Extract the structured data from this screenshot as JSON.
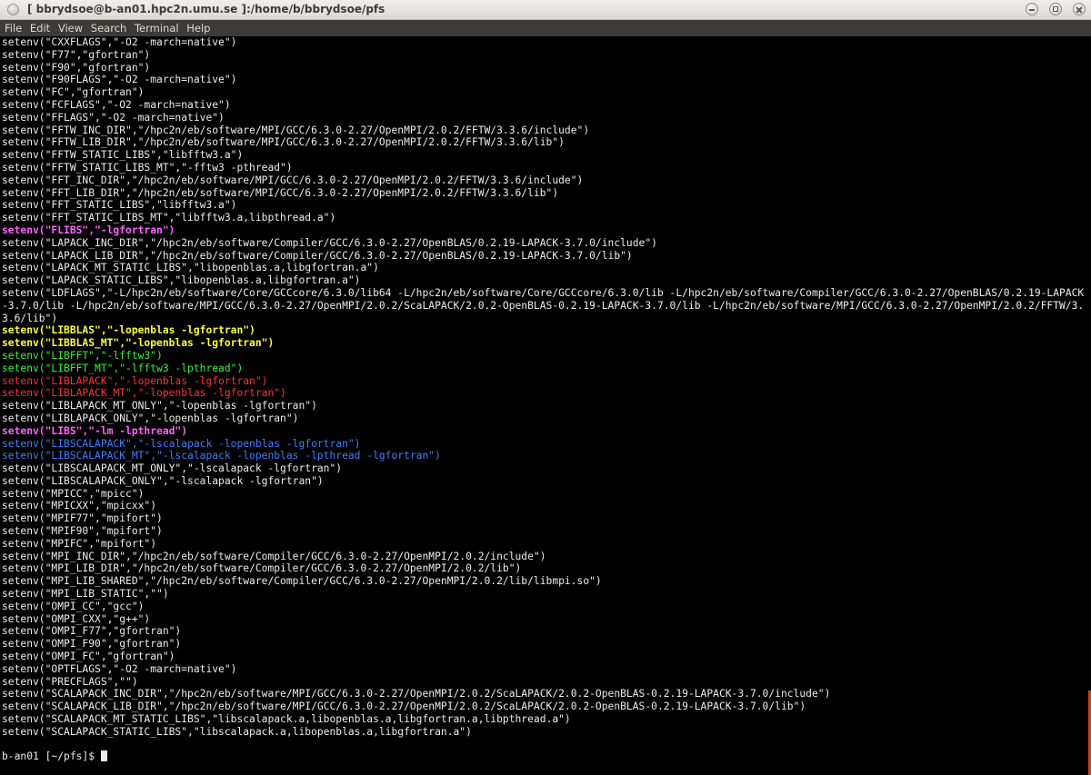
{
  "window": {
    "title": "[ bbrydsoe@b-an01.hpc2n.umu.se ]:/home/b/bbrydsoe/pfs"
  },
  "menubar": {
    "items": [
      "File",
      "Edit",
      "View",
      "Search",
      "Terminal",
      "Help"
    ]
  },
  "colors": {
    "magenta": "#ff62ff",
    "yellow": "#fdfd3a",
    "green": "#3bf03b",
    "red": "#ff3030",
    "blue": "#3f7dff",
    "default": "#ececec",
    "background": "#000000"
  },
  "terminal": {
    "lines": [
      {
        "text": "setenv(\"CXXFLAGS\",\"-O2 -march=native\")",
        "color": ""
      },
      {
        "text": "setenv(\"F77\",\"gfortran\")",
        "color": ""
      },
      {
        "text": "setenv(\"F90\",\"gfortran\")",
        "color": ""
      },
      {
        "text": "setenv(\"F90FLAGS\",\"-O2 -march=native\")",
        "color": ""
      },
      {
        "text": "setenv(\"FC\",\"gfortran\")",
        "color": ""
      },
      {
        "text": "setenv(\"FCFLAGS\",\"-O2 -march=native\")",
        "color": ""
      },
      {
        "text": "setenv(\"FFLAGS\",\"-O2 -march=native\")",
        "color": ""
      },
      {
        "text": "setenv(\"FFTW_INC_DIR\",\"/hpc2n/eb/software/MPI/GCC/6.3.0-2.27/OpenMPI/2.0.2/FFTW/3.3.6/include\")",
        "color": ""
      },
      {
        "text": "setenv(\"FFTW_LIB_DIR\",\"/hpc2n/eb/software/MPI/GCC/6.3.0-2.27/OpenMPI/2.0.2/FFTW/3.3.6/lib\")",
        "color": ""
      },
      {
        "text": "setenv(\"FFTW_STATIC_LIBS\",\"libfftw3.a\")",
        "color": ""
      },
      {
        "text": "setenv(\"FFTW_STATIC_LIBS_MT\",\"-fftw3 -pthread\")",
        "color": ""
      },
      {
        "text": "setenv(\"FFT_INC_DIR\",\"/hpc2n/eb/software/MPI/GCC/6.3.0-2.27/OpenMPI/2.0.2/FFTW/3.3.6/include\")",
        "color": ""
      },
      {
        "text": "setenv(\"FFT_LIB_DIR\",\"/hpc2n/eb/software/MPI/GCC/6.3.0-2.27/OpenMPI/2.0.2/FFTW/3.3.6/lib\")",
        "color": ""
      },
      {
        "text": "setenv(\"FFT_STATIC_LIBS\",\"libfftw3.a\")",
        "color": ""
      },
      {
        "text": "setenv(\"FFT_STATIC_LIBS_MT\",\"libfftw3.a,libpthread.a\")",
        "color": ""
      },
      {
        "text": "setenv(\"FLIBS\",\"-lgfortran\")",
        "color": "magenta"
      },
      {
        "text": "setenv(\"LAPACK_INC_DIR\",\"/hpc2n/eb/software/Compiler/GCC/6.3.0-2.27/OpenBLAS/0.2.19-LAPACK-3.7.0/include\")",
        "color": ""
      },
      {
        "text": "setenv(\"LAPACK_LIB_DIR\",\"/hpc2n/eb/software/Compiler/GCC/6.3.0-2.27/OpenBLAS/0.2.19-LAPACK-3.7.0/lib\")",
        "color": ""
      },
      {
        "text": "setenv(\"LAPACK_MT_STATIC_LIBS\",\"libopenblas.a,libgfortran.a\")",
        "color": ""
      },
      {
        "text": "setenv(\"LAPACK_STATIC_LIBS\",\"libopenblas.a,libgfortran.a\")",
        "color": ""
      },
      {
        "text": "setenv(\"LDFLAGS\",\"-L/hpc2n/eb/software/Core/GCCcore/6.3.0/lib64 -L/hpc2n/eb/software/Core/GCCcore/6.3.0/lib -L/hpc2n/eb/software/Compiler/GCC/6.3.0-2.27/OpenBLAS/0.2.19-LAPACK-3.7.0/lib -L/hpc2n/eb/software/MPI/GCC/6.3.0-2.27/OpenMPI/2.0.2/ScaLAPACK/2.0.2-OpenBLAS-0.2.19-LAPACK-3.7.0/lib -L/hpc2n/eb/software/MPI/GCC/6.3.0-2.27/OpenMPI/2.0.2/FFTW/3.3.6/lib\")",
        "color": "",
        "wrap": true
      },
      {
        "text": "setenv(\"LIBBLAS\",\"-lopenblas -lgfortran\")",
        "color": "yellow"
      },
      {
        "text": "setenv(\"LIBBLAS_MT\",\"-lopenblas -lgfortran\")",
        "color": "yellow"
      },
      {
        "text": "setenv(\"LIBFFT\",\"-lfftw3\")",
        "color": "green"
      },
      {
        "text": "setenv(\"LIBFFT_MT\",\"-lfftw3 -lpthread\")",
        "color": "green"
      },
      {
        "text": "setenv(\"LIBLAPACK\",\"-lopenblas -lgfortran\")",
        "color": "red"
      },
      {
        "text": "setenv(\"LIBLAPACK_MT\",\"-lopenblas -lgfortran\")",
        "color": "red"
      },
      {
        "text": "setenv(\"LIBLAPACK_MT_ONLY\",\"-lopenblas -lgfortran\")",
        "color": ""
      },
      {
        "text": "setenv(\"LIBLAPACK_ONLY\",\"-lopenblas -lgfortran\")",
        "color": ""
      },
      {
        "text": "setenv(\"LIBS\",\"-lm -lpthread\")",
        "color": "magenta"
      },
      {
        "text": "setenv(\"LIBSCALAPACK\",\"-lscalapack -lopenblas -lgfortran\")",
        "color": "blue"
      },
      {
        "text": "setenv(\"LIBSCALAPACK_MT\",\"-lscalapack -lopenblas -lpthread -lgfortran\")",
        "color": "blue"
      },
      {
        "text": "setenv(\"LIBSCALAPACK_MT_ONLY\",\"-lscalapack -lgfortran\")",
        "color": ""
      },
      {
        "text": "setenv(\"LIBSCALAPACK_ONLY\",\"-lscalapack -lgfortran\")",
        "color": ""
      },
      {
        "text": "setenv(\"MPICC\",\"mpicc\")",
        "color": ""
      },
      {
        "text": "setenv(\"MPICXX\",\"mpicxx\")",
        "color": ""
      },
      {
        "text": "setenv(\"MPIF77\",\"mpifort\")",
        "color": ""
      },
      {
        "text": "setenv(\"MPIF90\",\"mpifort\")",
        "color": ""
      },
      {
        "text": "setenv(\"MPIFC\",\"mpifort\")",
        "color": ""
      },
      {
        "text": "setenv(\"MPI_INC_DIR\",\"/hpc2n/eb/software/Compiler/GCC/6.3.0-2.27/OpenMPI/2.0.2/include\")",
        "color": ""
      },
      {
        "text": "setenv(\"MPI_LIB_DIR\",\"/hpc2n/eb/software/Compiler/GCC/6.3.0-2.27/OpenMPI/2.0.2/lib\")",
        "color": ""
      },
      {
        "text": "setenv(\"MPI_LIB_SHARED\",\"/hpc2n/eb/software/Compiler/GCC/6.3.0-2.27/OpenMPI/2.0.2/lib/libmpi.so\")",
        "color": ""
      },
      {
        "text": "setenv(\"MPI_LIB_STATIC\",\"\")",
        "color": ""
      },
      {
        "text": "setenv(\"OMPI_CC\",\"gcc\")",
        "color": ""
      },
      {
        "text": "setenv(\"OMPI_CXX\",\"g++\")",
        "color": ""
      },
      {
        "text": "setenv(\"OMPI_F77\",\"gfortran\")",
        "color": ""
      },
      {
        "text": "setenv(\"OMPI_F90\",\"gfortran\")",
        "color": ""
      },
      {
        "text": "setenv(\"OMPI_FC\",\"gfortran\")",
        "color": ""
      },
      {
        "text": "setenv(\"OPTFLAGS\",\"-O2 -march=native\")",
        "color": ""
      },
      {
        "text": "setenv(\"PRECFLAGS\",\"\")",
        "color": ""
      },
      {
        "text": "setenv(\"SCALAPACK_INC_DIR\",\"/hpc2n/eb/software/MPI/GCC/6.3.0-2.27/OpenMPI/2.0.2/ScaLAPACK/2.0.2-OpenBLAS-0.2.19-LAPACK-3.7.0/include\")",
        "color": ""
      },
      {
        "text": "setenv(\"SCALAPACK_LIB_DIR\",\"/hpc2n/eb/software/MPI/GCC/6.3.0-2.27/OpenMPI/2.0.2/ScaLAPACK/2.0.2-OpenBLAS-0.2.19-LAPACK-3.7.0/lib\")",
        "color": ""
      },
      {
        "text": "setenv(\"SCALAPACK_MT_STATIC_LIBS\",\"libscalapack.a,libopenblas.a,libgfortran.a,libpthread.a\")",
        "color": ""
      },
      {
        "text": "setenv(\"SCALAPACK_STATIC_LIBS\",\"libscalapack.a,libopenblas.a,libgfortran.a\")",
        "color": ""
      }
    ],
    "prompt": "b-an01 [~/pfs]$ "
  }
}
